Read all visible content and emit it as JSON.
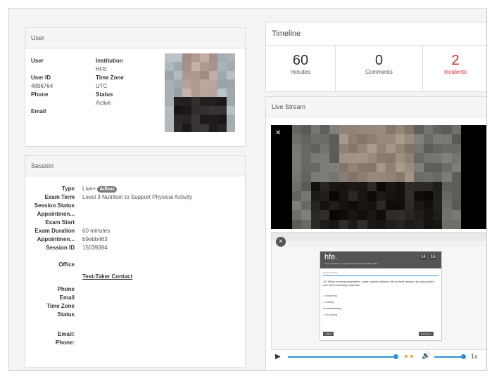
{
  "user": {
    "header": "User",
    "labels": {
      "user": "User",
      "user_id": "User ID",
      "phone": "Phone",
      "email": "Email",
      "institution": "Institution",
      "timezone": "Time Zone",
      "status": "Status"
    },
    "values": {
      "user_id": "4896764",
      "institution": "HFE",
      "timezone": "UTC",
      "status": "Active"
    }
  },
  "session": {
    "header": "Session",
    "labels": {
      "type": "Type",
      "exam_term": "Exam Term",
      "session_status": "Session Status",
      "appointment1": "Appointmen...",
      "exam_start": "Exam Start",
      "exam_duration": "Exam Duration",
      "appointment2": "Appointmen...",
      "session_id": "Session ID",
      "office": "Office",
      "phone": "Phone",
      "email": "Email",
      "timezone": "Time Zone",
      "status": "Status",
      "email2": "Email:",
      "phone2": "Phone:"
    },
    "values": {
      "type": "Live+",
      "badge": "Adhoc",
      "exam_term": "Level 3 Nutrition to Support Physical Activity",
      "exam_duration": "60 minutes",
      "appointment2": "b9ebb463",
      "session_id": "15039384"
    },
    "contact_link": "Test-Taker Contact"
  },
  "timeline": {
    "header": "Timeline",
    "metrics": [
      {
        "value": "60",
        "label": "minutes"
      },
      {
        "value": "0",
        "label": "Comments"
      },
      {
        "value": "2",
        "label": "Incidents"
      }
    ]
  },
  "live_stream": {
    "header": "Live Stream",
    "screen": {
      "logo": "hfe.",
      "course": "Level 3 Nutrition to Support Physical Activity (NSP) exam",
      "timer_a": "14",
      "timer_b": "16",
      "question_no": "Question 14/16",
      "question": "14. When cooking vegetables, water-soluble vitamins will be best retained by using which one of the following methods?",
      "options": [
        "steaming",
        "boiling",
        "microwaving",
        "stir-frying"
      ],
      "prev": "< Back",
      "summary": "Summary >"
    },
    "speed": "1x",
    "colors": {
      "accent": "#2f8fd8",
      "incident": "#d9272d"
    }
  }
}
